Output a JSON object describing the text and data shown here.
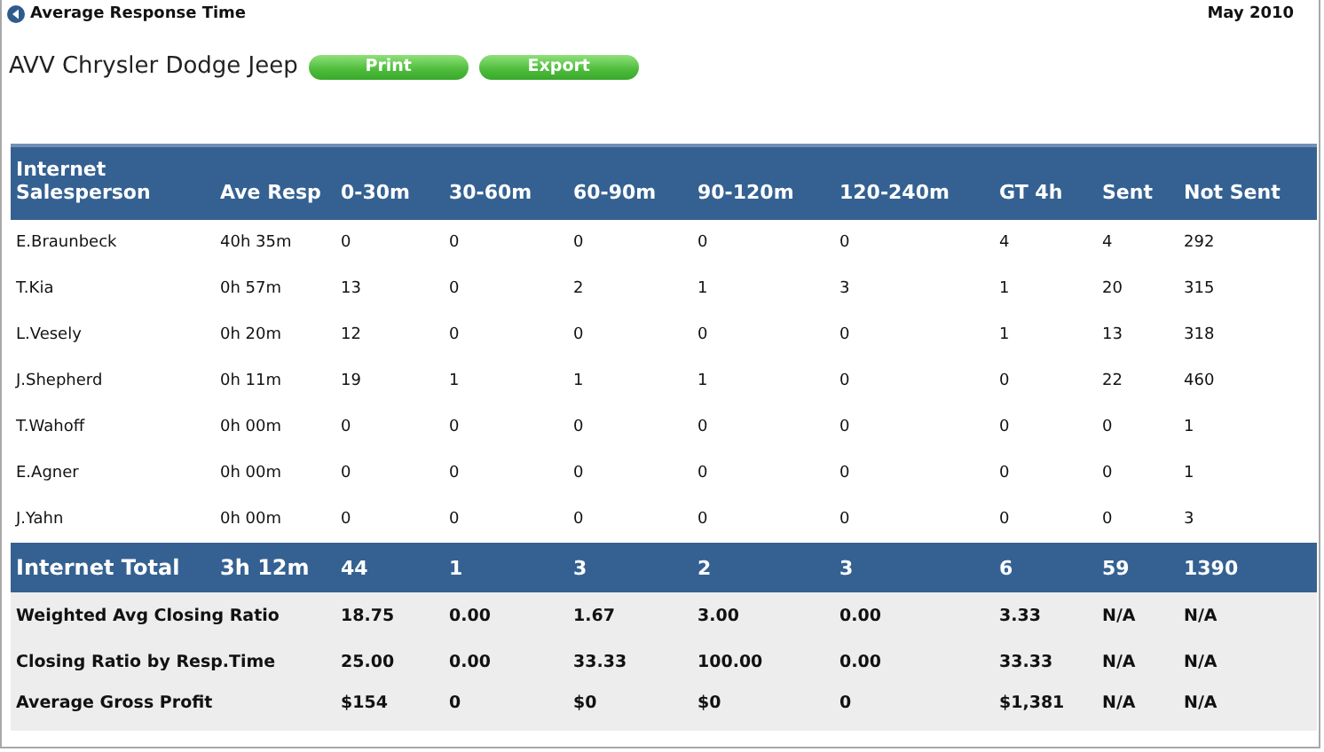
{
  "header": {
    "title": "Average Response Time",
    "period": "May 2010"
  },
  "dealer": "AVV Chrysler Dodge Jeep",
  "buttons": [
    "Print",
    "Export"
  ],
  "columns": [
    "Internet Salesperson",
    "Ave Resp",
    "0-30m",
    "30-60m",
    "60-90m",
    "90-120m",
    "120-240m",
    "GT 4h",
    "Sent",
    "Not Sent"
  ],
  "rows": [
    {
      "cells": [
        "E.Braunbeck",
        "40h 35m",
        "0",
        "0",
        "0",
        "0",
        "0",
        "4",
        "4",
        "292"
      ]
    },
    {
      "cells": [
        "T.Kia",
        "0h 57m",
        "13",
        "0",
        "2",
        "1",
        "3",
        "1",
        "20",
        "315"
      ]
    },
    {
      "cells": [
        "L.Vesely",
        "0h 20m",
        "12",
        "0",
        "0",
        "0",
        "0",
        "1",
        "13",
        "318"
      ]
    },
    {
      "cells": [
        "J.Shepherd",
        "0h 11m",
        "19",
        "1",
        "1",
        "1",
        "0",
        "0",
        "22",
        "460"
      ]
    },
    {
      "cells": [
        "T.Wahoff",
        "0h 00m",
        "0",
        "0",
        "0",
        "0",
        "0",
        "0",
        "0",
        "1"
      ]
    },
    {
      "cells": [
        "E.Agner",
        "0h 00m",
        "0",
        "0",
        "0",
        "0",
        "0",
        "0",
        "0",
        "1"
      ]
    },
    {
      "cells": [
        "J.Yahn",
        "0h 00m",
        "0",
        "0",
        "0",
        "0",
        "0",
        "0",
        "0",
        "3"
      ]
    }
  ],
  "total": {
    "cells": [
      "Internet Total",
      "3h 12m",
      "44",
      "1",
      "3",
      "2",
      "3",
      "6",
      "59",
      "1390"
    ]
  },
  "summary": [
    {
      "label": "Weighted Avg Closing Ratio",
      "values": [
        "18.75",
        "0.00",
        "1.67",
        "3.00",
        "0.00",
        "3.33",
        "N/A",
        "N/A"
      ]
    },
    {
      "label": "Closing Ratio by Resp.Time",
      "values": [
        "25.00",
        "0.00",
        "33.33",
        "100.00",
        "0.00",
        "33.33",
        "N/A",
        "N/A"
      ]
    },
    {
      "label": "Average Gross Profit",
      "values": [
        "$154",
        "0",
        "$0",
        "$0",
        "0",
        "$1,381",
        "N/A",
        "N/A"
      ]
    }
  ]
}
